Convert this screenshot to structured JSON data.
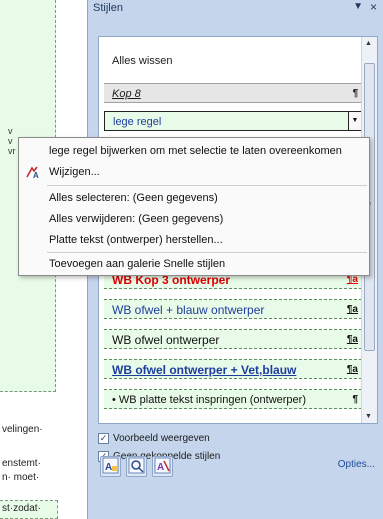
{
  "document": {
    "fragment_1": "v",
    "fragment_2": "v",
    "fragment_3": "vr",
    "line_1": "velingen·",
    "line_2": "enstemt·",
    "line_3": "n· moet·",
    "line_4": "st·zodat·"
  },
  "pane": {
    "title": "Stijlen",
    "dropdown_icon": "chevron-down-icon",
    "close_label": "×",
    "items": [
      {
        "label": "Alles wissen",
        "mark": ""
      },
      {
        "label": "Kop 8",
        "mark": "¶"
      },
      {
        "label": "lege regel",
        "mark": ""
      },
      {
        "label": "WB Kop 3 ontwerper",
        "mark": "¶a"
      },
      {
        "label": "WB ofwel + blauw ontwerper",
        "mark": "¶a"
      },
      {
        "label": "WB ofwel ontwerper",
        "mark": "¶a"
      },
      {
        "label": "WB ofwel ontwerper + Vet,blauw",
        "mark": "¶a"
      },
      {
        "label": "•  WB platte tekst inspringen (ontwerper)",
        "mark": "¶"
      }
    ],
    "show_preview": "Voorbeeld weergeven",
    "disable_linked": "Geen gekoppelde stijlen",
    "options": "Opties..."
  },
  "menu": {
    "items": [
      {
        "label": "lege regel bijwerken om met selectie te laten overeenkomen"
      },
      {
        "label": "Wijzigen..."
      },
      {
        "label": "Alles selecteren: (Geen gegevens)"
      },
      {
        "label": "Alles verwijderen: (Geen gegevens)"
      },
      {
        "label": "Platte tekst (ontwerper) herstellen..."
      },
      {
        "label": "Toevoegen aan galerie Snelle stijlen"
      }
    ]
  },
  "colors": {
    "pane_bg": "#c5d5ec",
    "style_green": "#e8fbe8",
    "heading_red": "#e00000",
    "link_blue": "#1d3d9e"
  }
}
